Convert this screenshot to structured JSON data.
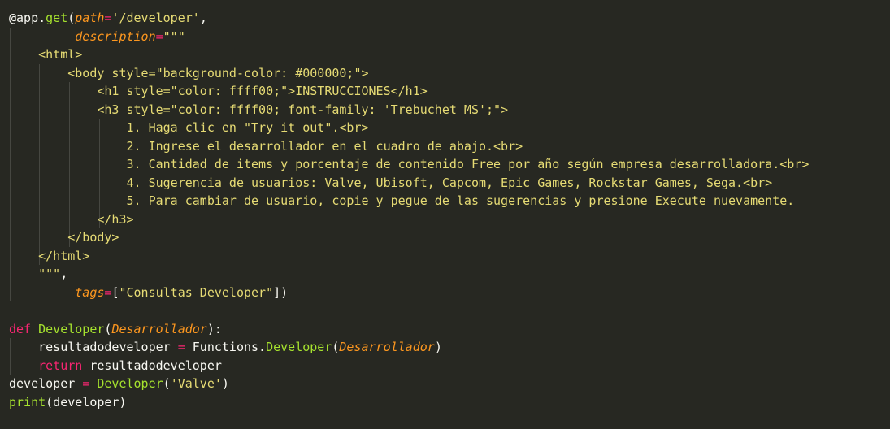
{
  "colors": {
    "background": "#272822",
    "default": "#f8f8f2",
    "keyword": "#f92672",
    "function": "#a6e22e",
    "string": "#e6db74",
    "parameter": "#fd971f",
    "indent_guide": "#464741"
  },
  "code": {
    "lines": [
      {
        "tokens": [
          {
            "t": "@app.",
            "c": "default"
          },
          {
            "t": "get",
            "c": "function"
          },
          {
            "t": "(",
            "c": "default"
          },
          {
            "t": "path",
            "c": "parameter",
            "i": true
          },
          {
            "t": "=",
            "c": "keyword"
          },
          {
            "t": "'/developer'",
            "c": "string"
          },
          {
            "t": ",",
            "c": "default"
          }
        ]
      },
      {
        "tokens": [
          {
            "t": "         ",
            "c": "default"
          },
          {
            "t": "description",
            "c": "parameter",
            "i": true
          },
          {
            "t": "=",
            "c": "keyword"
          },
          {
            "t": "\"\"\"",
            "c": "string"
          }
        ]
      },
      {
        "tokens": [
          {
            "t": "    <html>",
            "c": "string"
          }
        ]
      },
      {
        "tokens": [
          {
            "t": "        <body style=\"background-color: #000000;\">",
            "c": "string"
          }
        ]
      },
      {
        "tokens": [
          {
            "t": "            <h1 style=\"color: ffff00;\">INSTRUCCIONES</h1>",
            "c": "string"
          }
        ]
      },
      {
        "tokens": [
          {
            "t": "            <h3 style=\"color: ffff00; font-family: 'Trebuchet MS';\">",
            "c": "string"
          }
        ]
      },
      {
        "tokens": [
          {
            "t": "                1. Haga clic en \"Try it out\".<br>",
            "c": "string"
          }
        ]
      },
      {
        "tokens": [
          {
            "t": "                2. Ingrese el desarrollador en el cuadro de abajo.<br>",
            "c": "string"
          }
        ]
      },
      {
        "tokens": [
          {
            "t": "                3. Cantidad de items y porcentaje de contenido Free por año según empresa desarrolladora.<br>",
            "c": "string"
          }
        ]
      },
      {
        "tokens": [
          {
            "t": "                4. Sugerencia de usuarios: Valve, Ubisoft, Capcom, Epic Games, Rockstar Games, Sega.<br>",
            "c": "string"
          }
        ]
      },
      {
        "tokens": [
          {
            "t": "                5. Para cambiar de usuario, copie y pegue de las sugerencias y presione Execute nuevamente.",
            "c": "string"
          }
        ]
      },
      {
        "tokens": [
          {
            "t": "            </h3>",
            "c": "string"
          }
        ]
      },
      {
        "tokens": [
          {
            "t": "        </body>",
            "c": "string"
          }
        ]
      },
      {
        "tokens": [
          {
            "t": "    </html>",
            "c": "string"
          }
        ]
      },
      {
        "tokens": [
          {
            "t": "    \"\"\"",
            "c": "string"
          },
          {
            "t": ",",
            "c": "default"
          }
        ]
      },
      {
        "tokens": [
          {
            "t": "         ",
            "c": "default"
          },
          {
            "t": "tags",
            "c": "parameter",
            "i": true
          },
          {
            "t": "=",
            "c": "keyword"
          },
          {
            "t": "[",
            "c": "default"
          },
          {
            "t": "\"Consultas Developer\"",
            "c": "string"
          },
          {
            "t": "])",
            "c": "default"
          }
        ]
      },
      {
        "tokens": []
      },
      {
        "tokens": [
          {
            "t": "def",
            "c": "keyword"
          },
          {
            "t": " ",
            "c": "default"
          },
          {
            "t": "Developer",
            "c": "function"
          },
          {
            "t": "(",
            "c": "default"
          },
          {
            "t": "Desarrollador",
            "c": "parameter",
            "i": true
          },
          {
            "t": "):",
            "c": "default"
          }
        ]
      },
      {
        "tokens": [
          {
            "t": "    resultadodeveloper ",
            "c": "default"
          },
          {
            "t": "=",
            "c": "keyword"
          },
          {
            "t": " Functions.",
            "c": "default"
          },
          {
            "t": "Developer",
            "c": "function"
          },
          {
            "t": "(",
            "c": "default"
          },
          {
            "t": "Desarrollador",
            "c": "parameter",
            "i": true
          },
          {
            "t": ")",
            "c": "default"
          }
        ]
      },
      {
        "tokens": [
          {
            "t": "    ",
            "c": "default"
          },
          {
            "t": "return",
            "c": "keyword"
          },
          {
            "t": " resultadodeveloper",
            "c": "default"
          }
        ]
      },
      {
        "tokens": [
          {
            "t": "developer ",
            "c": "default"
          },
          {
            "t": "=",
            "c": "keyword"
          },
          {
            "t": " ",
            "c": "default"
          },
          {
            "t": "Developer",
            "c": "function"
          },
          {
            "t": "(",
            "c": "default"
          },
          {
            "t": "'Valve'",
            "c": "string"
          },
          {
            "t": ")",
            "c": "default"
          }
        ]
      },
      {
        "tokens": [
          {
            "t": "print",
            "c": "function"
          },
          {
            "t": "(developer)",
            "c": "default"
          }
        ]
      }
    ]
  }
}
